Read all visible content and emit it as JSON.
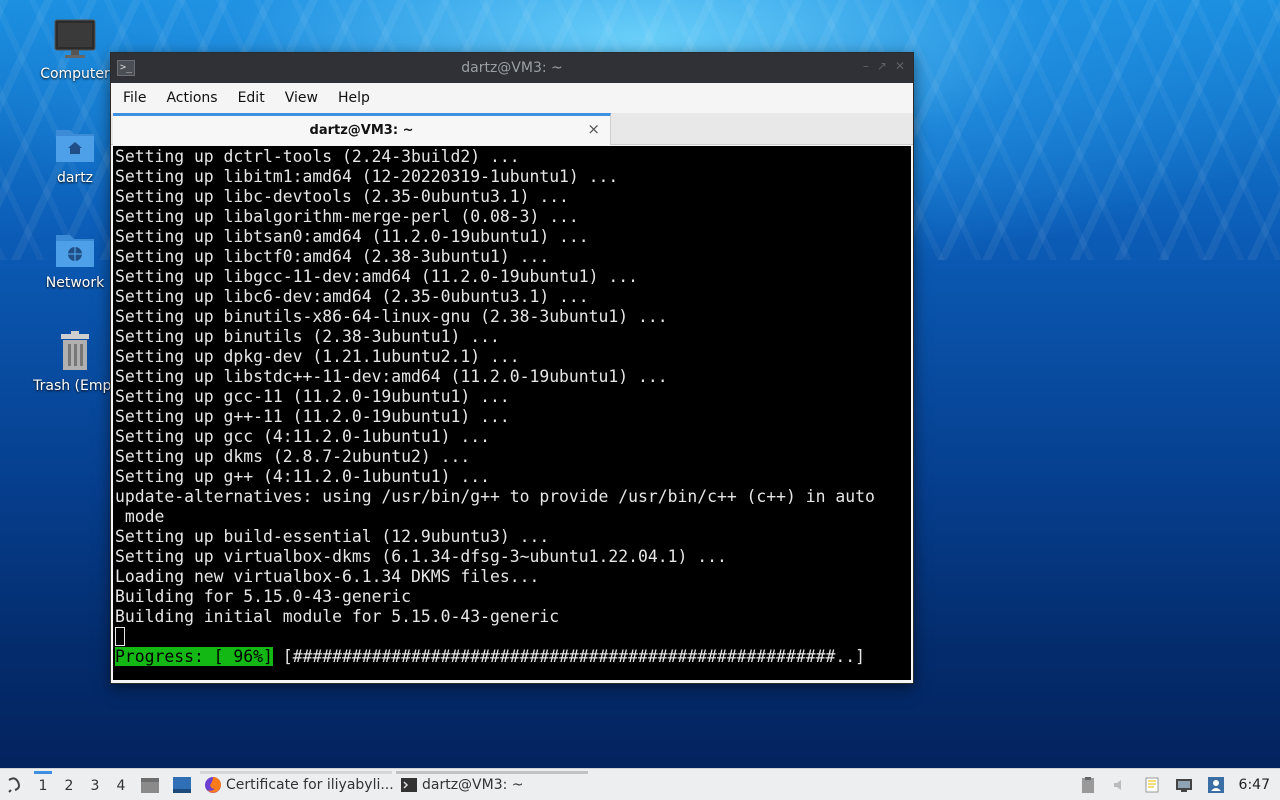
{
  "desktop": {
    "icons": [
      {
        "label": "Computer",
        "icon": "computer-icon"
      },
      {
        "label": "dartz",
        "icon": "home-folder-icon"
      },
      {
        "label": "Network",
        "icon": "network-folder-icon"
      },
      {
        "label": "Trash (Empt",
        "icon": "trash-icon"
      }
    ]
  },
  "window": {
    "title": "dartz@VM3: ~",
    "menu": [
      "File",
      "Actions",
      "Edit",
      "View",
      "Help"
    ],
    "tab_title": "dartz@VM3: ~",
    "tab_close": "×"
  },
  "terminal": {
    "lines": [
      "Setting up dctrl-tools (2.24-3build2) ...",
      "Setting up libitm1:amd64 (12-20220319-1ubuntu1) ...",
      "Setting up libc-devtools (2.35-0ubuntu3.1) ...",
      "Setting up libalgorithm-merge-perl (0.08-3) ...",
      "Setting up libtsan0:amd64 (11.2.0-19ubuntu1) ...",
      "Setting up libctf0:amd64 (2.38-3ubuntu1) ...",
      "Setting up libgcc-11-dev:amd64 (11.2.0-19ubuntu1) ...",
      "Setting up libc6-dev:amd64 (2.35-0ubuntu3.1) ...",
      "Setting up binutils-x86-64-linux-gnu (2.38-3ubuntu1) ...",
      "Setting up binutils (2.38-3ubuntu1) ...",
      "Setting up dpkg-dev (1.21.1ubuntu2.1) ...",
      "Setting up libstdc++-11-dev:amd64 (11.2.0-19ubuntu1) ...",
      "Setting up gcc-11 (11.2.0-19ubuntu1) ...",
      "Setting up g++-11 (11.2.0-19ubuntu1) ...",
      "Setting up gcc (4:11.2.0-1ubuntu1) ...",
      "Setting up dkms (2.8.7-2ubuntu2) ...",
      "Setting up g++ (4:11.2.0-1ubuntu1) ...",
      "update-alternatives: using /usr/bin/g++ to provide /usr/bin/c++ (c++) in auto",
      " mode",
      "Setting up build-essential (12.9ubuntu3) ...",
      "Setting up virtualbox-dkms (6.1.34-dfsg-3~ubuntu1.22.04.1) ...",
      "Loading new virtualbox-6.1.34 DKMS files...",
      "Building for 5.15.0-43-generic",
      "Building initial module for 5.15.0-43-generic"
    ],
    "progress_label": "Progress: [ 96%]",
    "progress_bar": " [#######################################################..]",
    "progress_percent": 96
  },
  "taskbar": {
    "workspaces": [
      "1",
      "2",
      "3",
      "4"
    ],
    "tasks": [
      {
        "label": "Certificate for iliyabyli...",
        "icon": "firefox-icon"
      },
      {
        "label": "dartz@VM3: ~",
        "icon": "terminal-icon"
      }
    ],
    "clock": "6:47",
    "colors": {
      "accent": "#3d8fe0",
      "progress_green": "#14b814"
    }
  }
}
